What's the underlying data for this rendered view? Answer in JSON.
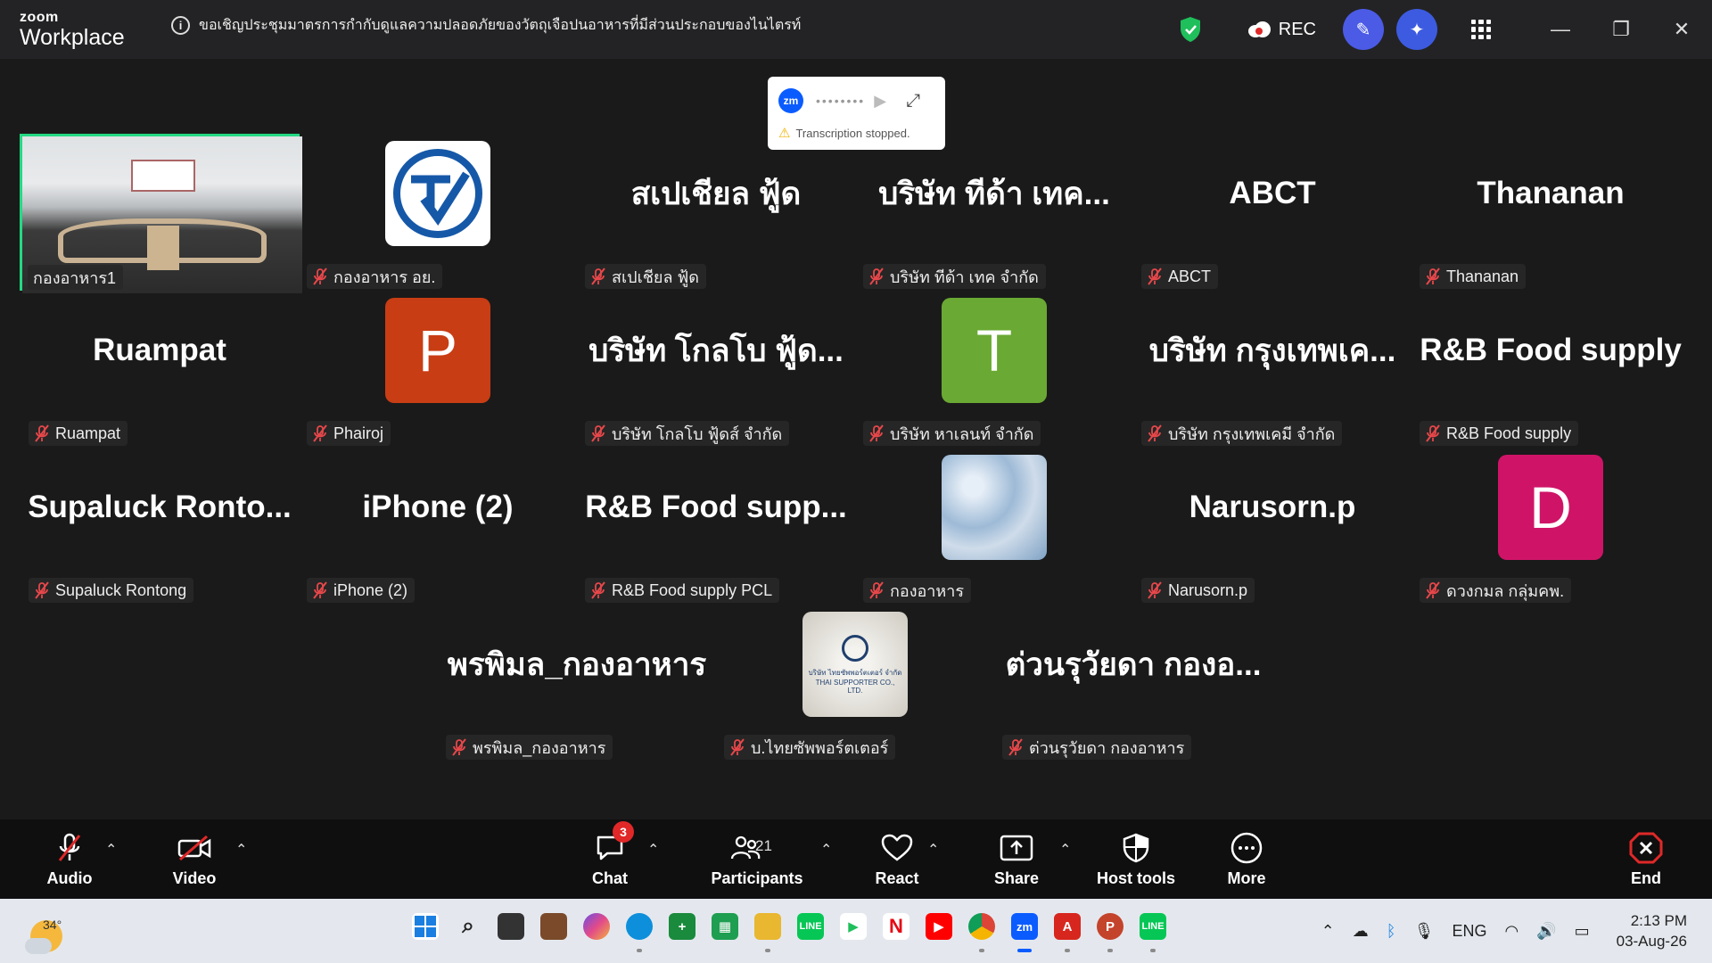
{
  "app": {
    "brand_line1": "zoom",
    "brand_line2": "Workplace"
  },
  "meeting": {
    "title": "ขอเชิญประชุมมาตรการกำกับดูแลความปลอดภัยของวัตถุเจือปนอาหารที่มีส่วนประกอบของไนไตรท์"
  },
  "titlebar": {
    "rec_label": "REC"
  },
  "transcription": {
    "logo": "zm",
    "dots": "••••••••",
    "status": "Transcription stopped."
  },
  "tiles": [
    {
      "big": "",
      "label": "กองอาหาร1",
      "kind": "video"
    },
    {
      "big": "",
      "label": "กองอาหาร อย.",
      "kind": "logo"
    },
    {
      "big": "สเปเชียล ฟู้ด",
      "label": "สเปเชียล ฟู้ด",
      "kind": "text"
    },
    {
      "big": "บริษัท ทีด้า เทค...",
      "label": "บริษัท ทีด้า เทค จำกัด",
      "kind": "text"
    },
    {
      "big": "ABCT",
      "label": "ABCT",
      "kind": "text"
    },
    {
      "big": "Thananan",
      "label": "Thananan",
      "kind": "text"
    },
    {
      "big": "Ruampat",
      "label": "Ruampat",
      "kind": "text"
    },
    {
      "big": "P",
      "label": "Phairoj",
      "kind": "avatar",
      "color": "#c83d14"
    },
    {
      "big": "บริษัท โกลโบ ฟู้ด...",
      "label": "บริษัท โกลโบ ฟู้ดส์ จำกัด",
      "kind": "text"
    },
    {
      "big": "T",
      "label": "บริษัท หาเลนท์ จำกัด",
      "kind": "avatar",
      "color": "#6aa933"
    },
    {
      "big": "บริษัท กรุงเทพเค...",
      "label": "บริษัท กรุงเทพเคมี จำกัด",
      "kind": "text"
    },
    {
      "big": "R&B Food supply",
      "label": "R&B Food supply",
      "kind": "text"
    },
    {
      "big": "Supaluck  Ronto...",
      "label": "Supaluck Rontong",
      "kind": "text"
    },
    {
      "big": "iPhone (2)",
      "label": "iPhone (2)",
      "kind": "text"
    },
    {
      "big": "R&B  Food  supp...",
      "label": "R&B Food supply PCL",
      "kind": "text"
    },
    {
      "big": "",
      "label": "กองอาหาร",
      "kind": "sky"
    },
    {
      "big": "Narusorn.p",
      "label": "Narusorn.p",
      "kind": "text"
    },
    {
      "big": "D",
      "label": "ดวงกมล กลุ่มคพ.",
      "kind": "avatar",
      "color": "#cf1467"
    },
    {
      "big": "พรพิมล_กองอาหาร",
      "label": "พรพิมล_กองอาหาร",
      "kind": "text"
    },
    {
      "big": "",
      "label": "บ.ไทยซัพพอร์ตเตอร์",
      "kind": "company"
    },
    {
      "big": "ต่วนรุวัยดา กองอ...",
      "label": "ต่วนรุวัยดา กองอาหาร",
      "kind": "text"
    }
  ],
  "company_logo_text": "บริษัท ไทยซัพพอร์ตเตอร์ จำกัด THAI SUPPORTER CO., LTD.",
  "toolbar": {
    "audio": "Audio",
    "video": "Video",
    "chat": "Chat",
    "chat_badge": "3",
    "participants": "Participants",
    "participants_count": "21",
    "react": "React",
    "share": "Share",
    "host_tools": "Host tools",
    "more": "More",
    "end": "End"
  },
  "taskbar": {
    "temperature": "34°",
    "language": "ENG",
    "time": "2:13 PM",
    "date": "03-Aug-26"
  },
  "colors": {
    "active_border": "#23d983",
    "toolbar_bg": "#0f0f0f",
    "stage_bg": "#1a1a1a",
    "taskbar_bg": "#e4e8ee"
  }
}
